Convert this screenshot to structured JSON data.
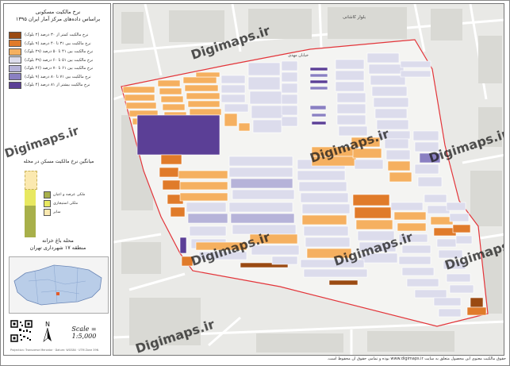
{
  "legend": {
    "title_line1": "نرخ مالکیت مسکونی",
    "title_line2": "براساس داده‌های مرکز آمار ایران ۱۳۹۵",
    "items": [
      {
        "label": "نرخ مالکیت کمتر از ۳۰ درصد (۲ بلوک)",
        "color": "#9a4a12"
      },
      {
        "label": "نرخ مالکیت بین ۳۱ تا ۴۰ درصد (۹ بلوک)",
        "color": "#e07b2a"
      },
      {
        "label": "نرخ مالکیت بین ۴۱ تا ۵۰ درصد (۲۹ بلوک)",
        "color": "#f5b060"
      },
      {
        "label": "نرخ مالکیت بین ۵۱ تا ۶۰ درصد (۳۹ بلوک)",
        "color": "#dcdcec"
      },
      {
        "label": "نرخ مالکیت بین ۶۱ تا ۷۰ درصد (۲۶ بلوک)",
        "color": "#b6b3d9"
      },
      {
        "label": "نرخ مالکیت بین ۷۱ تا ۸۰ درصد (۹ بلوک)",
        "color": "#8a80c2"
      },
      {
        "label": "نرخ مالکیت بیشتر از ۸۱ درصد (۴ بلوک)",
        "color": "#5b3f96"
      }
    ]
  },
  "ownership": {
    "title": "میانگین نرخ مالکیت مسکن در محله",
    "items": [
      {
        "label": "ملکی عرصه و اعیان",
        "color": "#a8b04a"
      },
      {
        "label": "ملکی استیجاری",
        "color": "#e8e860"
      },
      {
        "label": "سایر",
        "color": "#fbe9b0"
      }
    ]
  },
  "area": {
    "title_line1": "محله باغ خزانه",
    "title_line2": "منطقه ۱۷ شهرداری تهران"
  },
  "scale_label": "Scale = 1:5,000",
  "footer_small": "Projection: Transverse Mercator · Datum: WGS84 · UTM Zone 39N",
  "credit": "حقوق مالکیت معنوی این محصول متعلق به سایت www.digimaps.ir بوده و تمامی حقوق آن محفوظ است.",
  "watermark": "Digimaps.ir",
  "colors": {
    "boundary": "#e3353a",
    "road": "#ffffff",
    "bg": "#e9e9e6"
  },
  "map_labels": [
    "بلوار کاشانی",
    "خیابان مهدی"
  ]
}
